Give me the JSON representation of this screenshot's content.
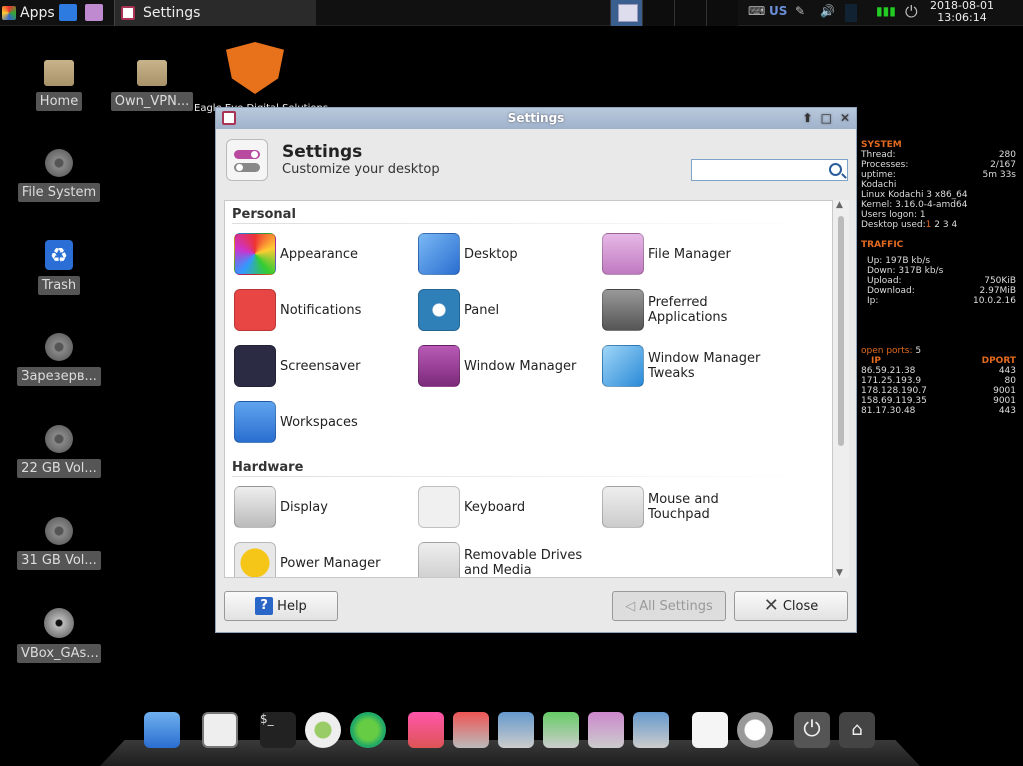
{
  "top_panel": {
    "apps_label": "Apps",
    "task_label": "Settings",
    "keyboard_layout": "US",
    "clock_date": "2018-08-01",
    "clock_time": "13:06:14"
  },
  "desktop_icons": [
    {
      "label": "Home",
      "icon": "folder-home-icon"
    },
    {
      "label": "Own_VPN...",
      "icon": "folder-icon"
    },
    {
      "label": "File System",
      "icon": "drive-icon"
    },
    {
      "label": "Trash",
      "icon": "trash-icon"
    },
    {
      "label": "Зарезерв...",
      "icon": "drive-icon"
    },
    {
      "label": "22 GB Vol...",
      "icon": "drive-icon"
    },
    {
      "label": "31 GB Vol...",
      "icon": "drive-icon"
    },
    {
      "label": "VBox_GAs...",
      "icon": "cd-icon"
    }
  ],
  "logo_text": "Eagle Eye Digital Solutions",
  "window": {
    "title": "Settings",
    "header_title": "Settings",
    "header_subtitle": "Customize your desktop",
    "search_value": "",
    "sections": [
      {
        "title": "Personal",
        "items": [
          {
            "label": "Appearance",
            "icon": "appearance-icon",
            "color": "#d43f8d"
          },
          {
            "label": "Desktop",
            "icon": "desktop-icon",
            "color": "#3d8be0"
          },
          {
            "label": "File Manager",
            "icon": "file-manager-icon",
            "color": "#c07ac0"
          },
          {
            "label": "Notifications",
            "icon": "notifications-icon",
            "color": "#e84545"
          },
          {
            "label": "Panel",
            "icon": "panel-icon",
            "color": "#2f7fb8"
          },
          {
            "label": "Preferred Applications",
            "icon": "preferred-apps-icon",
            "color": "#777777"
          },
          {
            "label": "Screensaver",
            "icon": "screensaver-icon",
            "color": "#2b2b44"
          },
          {
            "label": "Window Manager",
            "icon": "window-manager-icon",
            "color": "#9c3a9a"
          },
          {
            "label": "Window Manager Tweaks",
            "icon": "wm-tweaks-icon",
            "color": "#3aa0e0"
          },
          {
            "label": "Workspaces",
            "icon": "workspaces-icon",
            "color": "#3d8be0"
          }
        ]
      },
      {
        "title": "Hardware",
        "items": [
          {
            "label": "Display",
            "icon": "display-icon",
            "color": "#cccccc"
          },
          {
            "label": "Keyboard",
            "icon": "keyboard-icon",
            "color": "#eeeeee"
          },
          {
            "label": "Mouse and Touchpad",
            "icon": "mouse-icon",
            "color": "#dddddd"
          },
          {
            "label": "Power Manager",
            "icon": "power-manager-icon",
            "color": "#f5c518"
          },
          {
            "label": "Removable Drives and Media",
            "icon": "eject-icon",
            "color": "#dddddd"
          }
        ]
      }
    ],
    "buttons": {
      "help": "Help",
      "all_settings": "All Settings",
      "close": "Close"
    }
  },
  "conky": {
    "system_title": "SYSTEM",
    "system_rows": [
      [
        "Thread:",
        "280"
      ],
      [
        "Processes:",
        "2/167"
      ],
      [
        "uptime:",
        "5m 33s"
      ]
    ],
    "host_lines": [
      "Kodachi",
      "Linux Kodachi 3  x86_64",
      "Kernel: 3.16.0-4-amd64",
      "Users logon: 1"
    ],
    "desktop_used_label": "Desktop used:",
    "desktop_used_current": "1",
    "desktop_used_rest": "2 3 4",
    "traffic_title": "TRAFFIC",
    "up_line": "Up: 197B   kb/s",
    "down_line": "Down: 317B   kb/s",
    "traffic_rows": [
      [
        "Upload:",
        "750KiB"
      ],
      [
        "Download:",
        "2.97MiB"
      ],
      [
        "Ip:",
        "10.0.2.16"
      ]
    ],
    "ports_label": "open ports:",
    "ports_count": "5",
    "ip_header": "IP",
    "dport_header": "DPORT",
    "connections": [
      [
        "86.59.21.38",
        "443"
      ],
      [
        "171.25.193.9",
        "80"
      ],
      [
        "178.128.190.7",
        "9001"
      ],
      [
        "158.69.119.35",
        "9001"
      ],
      [
        "81.17.30.48",
        "443"
      ]
    ]
  },
  "dock_items": [
    "monitor-icon",
    "settings-icon",
    "terminal-icon",
    "disk-usage-icon",
    "globe-icon",
    "package-icon",
    "tools-icon",
    "network-icon",
    "mail-icon",
    "files-icon",
    "wifi-icon",
    "text-editor-icon",
    "search-app-icon",
    "power-icon",
    "home-icon"
  ]
}
